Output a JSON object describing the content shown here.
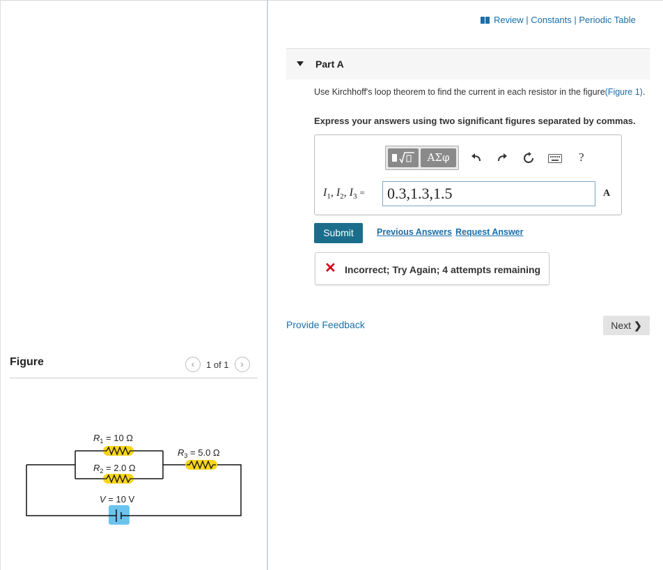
{
  "header": {
    "links": [
      "Review",
      "Constants",
      "Periodic Table"
    ],
    "separator": " | "
  },
  "part": {
    "label": "Part A",
    "question_text": "Use Kirchhoff's loop theorem to find the current in each resistor in the figure",
    "figure_link": "(Figure 1)",
    "question_end": ".",
    "instruction": "Express your answers using two significant figures separated by commas."
  },
  "toolbar": {
    "templates_label": "√",
    "greek_label": "ΑΣφ",
    "undo_icon": "undo-icon",
    "redo_icon": "redo-icon",
    "reset_icon": "reset-icon",
    "keyboard_icon": "keyboard-icon",
    "help_label": "?"
  },
  "answer": {
    "vars": [
      "I",
      "1",
      "I",
      "2",
      "I",
      "3"
    ],
    "equals": "=",
    "value": "0.3,1.3,1.5",
    "unit": "A"
  },
  "actions": {
    "submit": "Submit",
    "previous_answers": "Previous Answers",
    "request_answer": "Request Answer"
  },
  "feedback": {
    "status": "Incorrect; Try Again; 4 attempts remaining",
    "status_color": "#d6001c"
  },
  "footer": {
    "provide_feedback": "Provide Feedback",
    "next": "Next"
  },
  "figure": {
    "title": "Figure",
    "pager": "1 of 1",
    "labels": {
      "r1": "R",
      "r1_sub": "1",
      "r1_val": " = 10 Ω",
      "r2": "R",
      "r2_sub": "2",
      "r2_val": " = 2.0 Ω",
      "r3": "R",
      "r3_sub": "3",
      "r3_val": " = 5.0 Ω",
      "v": "V",
      "v_val": " = 10 V"
    },
    "resistor_color": "#f7d51d",
    "battery_color": "#6cc4ee"
  },
  "colors": {
    "link": "#1a6ea8",
    "submit_bg": "#1a6e8c"
  }
}
